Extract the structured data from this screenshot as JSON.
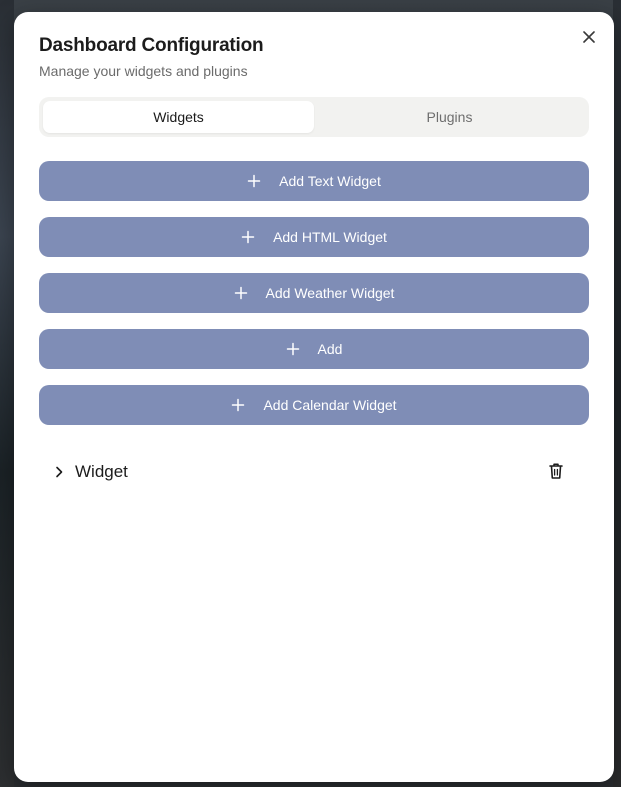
{
  "modal": {
    "title": "Dashboard Configuration",
    "subtitle": "Manage your widgets and plugins",
    "close_icon": "close-icon"
  },
  "tabs": [
    {
      "label": "Widgets",
      "active": true
    },
    {
      "label": "Plugins",
      "active": false
    }
  ],
  "buttons": [
    {
      "label": "Add Text Widget",
      "icon": "plus-icon"
    },
    {
      "label": "Add HTML Widget",
      "icon": "plus-icon"
    },
    {
      "label": "Add Weather Widget",
      "icon": "plus-icon"
    },
    {
      "label": "Add",
      "icon": "plus-icon"
    },
    {
      "label": "Add Calendar Widget",
      "icon": "plus-icon"
    }
  ],
  "widget_list": [
    {
      "label": "Widget",
      "expand_icon": "chevron-right-icon",
      "delete_icon": "trash-icon"
    }
  ],
  "colors": {
    "accent": "#7f8db6",
    "tab_bg": "#f2f2f0",
    "text": "#1c1c1c",
    "muted": "#6b6b6b"
  }
}
